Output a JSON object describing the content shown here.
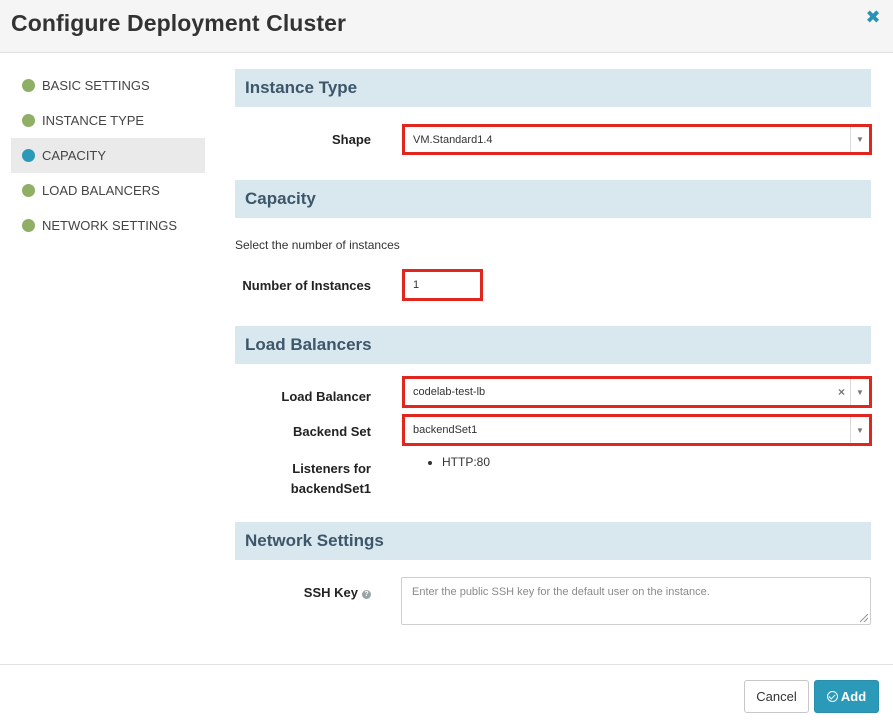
{
  "dialog": {
    "title": "Configure Deployment Cluster",
    "close_icon": "close-icon"
  },
  "nav": {
    "items": [
      {
        "label": "BASIC SETTINGS",
        "status_color": "#8fae66"
      },
      {
        "label": "INSTANCE TYPE",
        "status_color": "#8fae66"
      },
      {
        "label": "CAPACITY",
        "status_color": "#2b9ab9",
        "active": true
      },
      {
        "label": "LOAD BALANCERS",
        "status_color": "#8fae66"
      },
      {
        "label": "NETWORK SETTINGS",
        "status_color": "#8fae66"
      }
    ]
  },
  "instance_type": {
    "heading": "Instance Type",
    "shape_label": "Shape",
    "shape_value": "VM.Standard1.4"
  },
  "capacity": {
    "heading": "Capacity",
    "hint": "Select the number of instances",
    "instances_label": "Number of Instances",
    "instances_value": "1"
  },
  "load_balancers": {
    "heading": "Load Balancers",
    "lb_label": "Load Balancer",
    "lb_value": "codelab-test-lb",
    "backend_label": "Backend Set",
    "backend_value": "backendSet1",
    "listeners_label_line1": "Listeners for",
    "listeners_label_line2": "backendSet1",
    "listeners": [
      "HTTP:80"
    ]
  },
  "network": {
    "heading": "Network Settings",
    "ssh_label": "SSH Key",
    "ssh_placeholder": "Enter the public SSH key for the default user on the instance."
  },
  "footer": {
    "cancel_label": "Cancel",
    "add_label": "Add"
  },
  "colors": {
    "accent": "#2b9ab9",
    "highlight": "#e0261d",
    "section_bg": "#d8e8ee"
  }
}
